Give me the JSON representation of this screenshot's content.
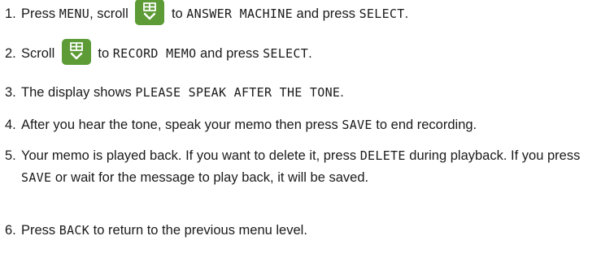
{
  "steps": [
    {
      "num": "1.",
      "parts": [
        {
          "t": "text",
          "v": "Press "
        },
        {
          "t": "lcd",
          "v": "MENU"
        },
        {
          "t": "text",
          "v": ", scroll "
        },
        {
          "t": "icon",
          "v": "scroll-button-icon"
        },
        {
          "t": "text",
          "v": " to "
        },
        {
          "t": "lcd",
          "v": "ANSWER MACHINE"
        },
        {
          "t": "text",
          "v": " and press "
        },
        {
          "t": "lcd",
          "v": "SELECT"
        },
        {
          "t": "text",
          "v": "."
        }
      ]
    },
    {
      "num": "2.",
      "parts": [
        {
          "t": "text",
          "v": "Scroll "
        },
        {
          "t": "icon",
          "v": "scroll-button-icon"
        },
        {
          "t": "text",
          "v": " to "
        },
        {
          "t": "lcd",
          "v": "RECORD MEMO"
        },
        {
          "t": "text",
          "v": " and press "
        },
        {
          "t": "lcd",
          "v": "SELECT"
        },
        {
          "t": "text",
          "v": "."
        }
      ]
    },
    {
      "num": "3.",
      "parts": [
        {
          "t": "text",
          "v": "The display shows "
        },
        {
          "t": "lcd",
          "v": "PLEASE SPEAK AFTER THE TONE"
        },
        {
          "t": "text",
          "v": "."
        }
      ]
    },
    {
      "num": "4.",
      "parts": [
        {
          "t": "text",
          "v": "After you hear the tone, speak your memo then press "
        },
        {
          "t": "lcd",
          "v": "SAVE"
        },
        {
          "t": "text",
          "v": " to end recording."
        }
      ]
    },
    {
      "num": "5.",
      "parts": [
        {
          "t": "text",
          "v": "Your memo is played back. If you want to delete it, press "
        },
        {
          "t": "lcd",
          "v": "DELETE"
        },
        {
          "t": "text",
          "v": " during playback. If you press "
        },
        {
          "t": "lcd",
          "v": "SAVE"
        },
        {
          "t": "text",
          "v": " or wait for the message to play back, it will be saved."
        }
      ]
    },
    {
      "num": "6.",
      "parts": [
        {
          "t": "text",
          "v": "Press "
        },
        {
          "t": "lcd",
          "v": "BACK"
        },
        {
          "t": "text",
          "v": " to return to the previous menu level."
        }
      ]
    }
  ],
  "colors": {
    "scroll_button": "#5c9b36",
    "text": "#1a1a1a"
  }
}
